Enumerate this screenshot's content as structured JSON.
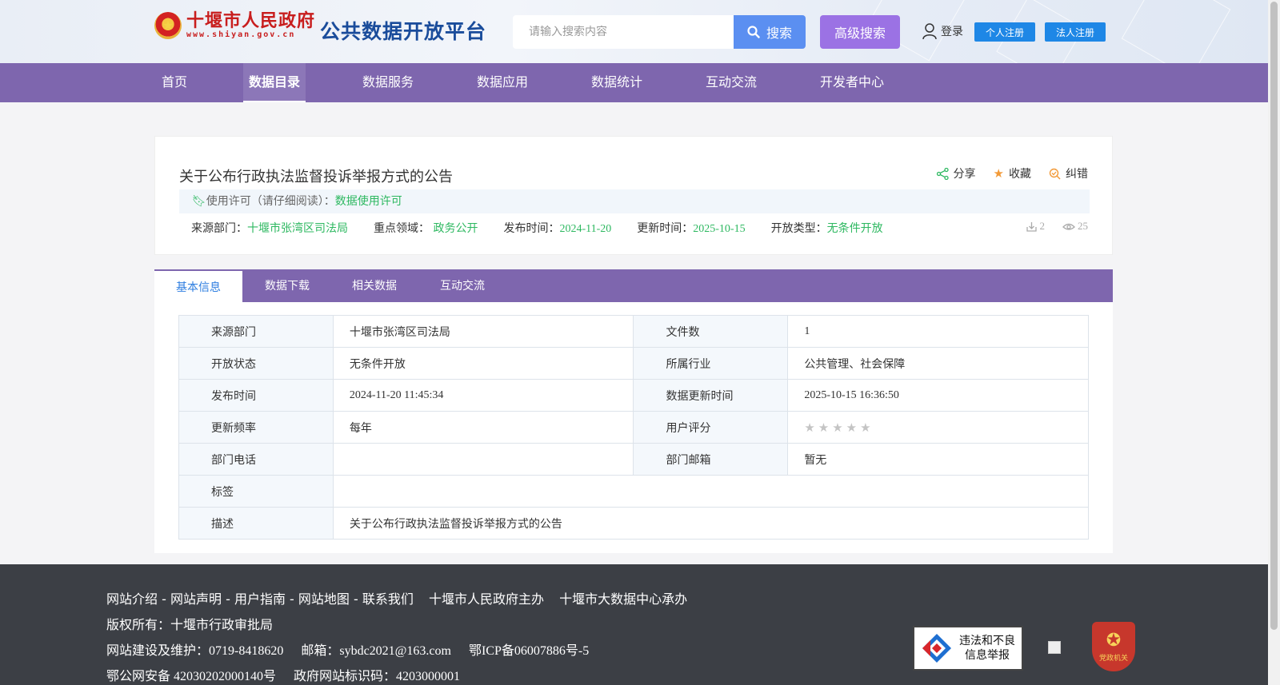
{
  "header": {
    "site_name": "十堰市人民政府",
    "site_url": "www.shiyan.gov.cn",
    "platform_title": "公共数据开放平台",
    "search_placeholder": "请输入搜索内容",
    "search_label": "搜索",
    "advanced_search_label": "高级搜索",
    "login_label": "登录",
    "personal_register_label": "个人注册",
    "legal_register_label": "法人注册"
  },
  "nav": {
    "items": [
      "首页",
      "数据目录",
      "数据服务",
      "数据应用",
      "数据统计",
      "互动交流",
      "开发者中心"
    ],
    "active": "数据目录"
  },
  "dataset": {
    "title": "关于公布行政执法监督投诉举报方式的公告",
    "actions": {
      "share": "分享",
      "favorite": "收藏",
      "correct": "纠错"
    },
    "license_prefix": "使用许可（请仔细阅读）：",
    "license_link": "数据使用许可",
    "meta": {
      "source_label": "来源部门：",
      "source_value": "十堰市张湾区司法局",
      "domain_label": "重点领域：",
      "domain_value": "政务公开",
      "publish_label": "发布时间：",
      "publish_value": "2024-11-20",
      "update_label": "更新时间：",
      "update_value": "2025-10-15",
      "open_label": "开放类型：",
      "open_value": "无条件开放"
    },
    "download_count": "2",
    "view_count": "25"
  },
  "tabs": {
    "items": [
      "基本信息",
      "数据下载",
      "相关数据",
      "互动交流"
    ],
    "active": "基本信息"
  },
  "info_table": {
    "source_dept_label": "来源部门",
    "source_dept_value": "十堰市张湾区司法局",
    "file_count_label": "文件数",
    "file_count_value": "1",
    "open_status_label": "开放状态",
    "open_status_value": "无条件开放",
    "industry_label": "所属行业",
    "industry_value": "公共管理、社会保障",
    "publish_time_label": "发布时间",
    "publish_time_value": "2024-11-20 11:45:34",
    "update_time_label": "数据更新时间",
    "update_time_value": "2025-10-15 16:36:50",
    "frequency_label": "更新频率",
    "frequency_value": "每年",
    "rating_label": "用户评分",
    "rating_value": 0,
    "rating_max": 5,
    "phone_label": "部门电话",
    "phone_value": "",
    "email_label": "部门邮箱",
    "email_value": "暂无",
    "tags_label": "标签",
    "tags_value": "",
    "desc_label": "描述",
    "desc_value": "关于公布行政执法监督投诉举报方式的公告"
  },
  "footer": {
    "links": [
      "网站介绍",
      "网站声明",
      "用户指南",
      "网站地图",
      "联系我们"
    ],
    "link_separator": " - ",
    "host": "十堰市人民政府主办",
    "organizer": "十堰市大数据中心承办",
    "copyright": "版权所有：十堰市行政审批局",
    "maintenance": "网站建设及维护：0719-8418620",
    "email": "邮箱：sybdc2021@163.com",
    "icp": "鄂ICP备06007886号-5",
    "police": "鄂公网安备 42030202000140号",
    "gov_id": "政府网站标识码：4203000001",
    "report_line1": "违法和不良",
    "report_line2": "信息举报",
    "badge_text": "党政机关"
  },
  "colors": {
    "nav_bg": "#7e66ae",
    "search_btn": "#5b8ff1",
    "advanced_btn": "#9b72e4",
    "register_btn": "#1e87e6",
    "accent_green": "#2db860",
    "tab_active_text": "#2e7ee0",
    "footer_bg": "#3c3f45"
  }
}
